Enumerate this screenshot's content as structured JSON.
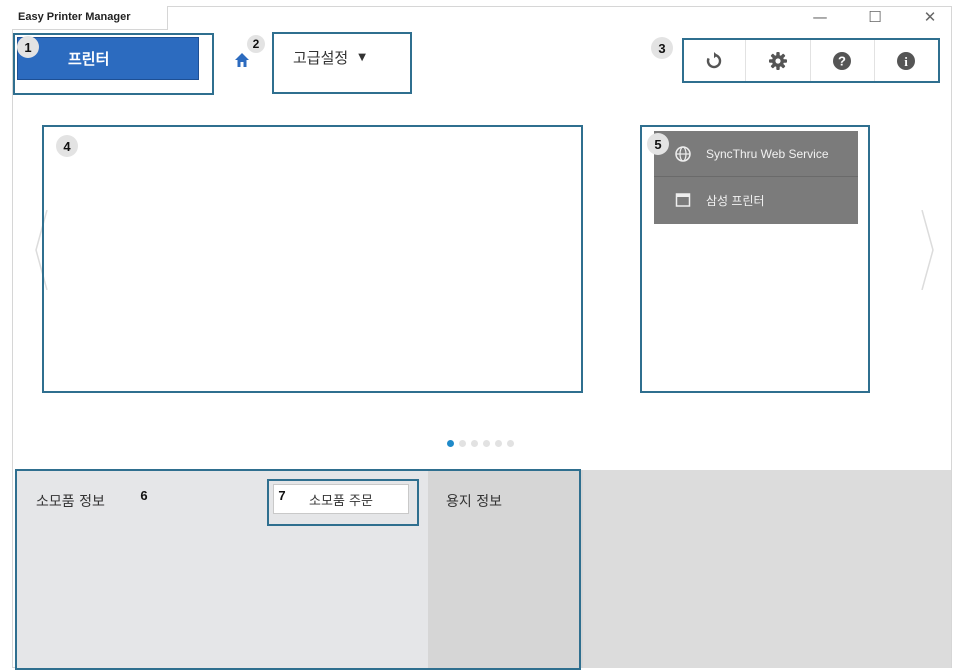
{
  "window": {
    "title": "Easy Printer Manager",
    "controls": {
      "minimize": "—",
      "maximize": "☐",
      "close": "✕"
    }
  },
  "header": {
    "printer_button_label": "프린터",
    "home_icon": "home-icon",
    "advanced_settings_label": "고급설정",
    "advanced_settings_caret": "▼",
    "toolbar_icons": [
      "refresh-icon",
      "settings-icon",
      "help-icon",
      "info-icon"
    ]
  },
  "main": {
    "side_menu": [
      {
        "label": "SyncThru Web Service",
        "icon": "globe-icon"
      },
      {
        "label": "삼성 프린터",
        "icon": "window-icon"
      }
    ],
    "pagination": {
      "total": 6,
      "active": 1
    }
  },
  "bottom": {
    "supplies_label": "소모품 정보",
    "order_supplies_label": "소모품 주문",
    "paper_info_label": "용지 정보"
  },
  "callouts": [
    "1",
    "2",
    "3",
    "4",
    "5",
    "6",
    "7"
  ],
  "colors": {
    "printer_button": "#2c6bbf",
    "callout_border": "#2f6f8f",
    "active_dot": "#1f8ac9",
    "menu_bg": "#7b7b7b"
  }
}
